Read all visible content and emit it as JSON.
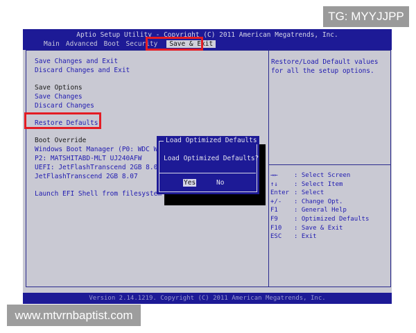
{
  "header": {
    "title": "Aptio Setup Utility - Copyright (C) 2011 American Megatrends, Inc.",
    "tabs": [
      "Main",
      "Advanced",
      "Boot",
      "Security",
      "Save & Exit"
    ]
  },
  "menu": {
    "save_changes_and_exit": "Save Changes and Exit",
    "discard_changes_and_exit": "Discard Changes and Exit",
    "save_options_heading": "Save Options",
    "save_changes": "Save Changes",
    "discard_changes": "Discard Changes",
    "restore_defaults": "Restore Defaults",
    "boot_override_heading": "Boot Override",
    "boot_items": [
      "Windows Boot Manager (P0: WDC WD7",
      "P2: MATSHITABD-MLT UJ240AFW",
      "UEFI: JetFlashTranscend 2GB 8.07",
      "JetFlashTranscend 2GB 8.07"
    ],
    "launch_efi_shell": "Launch EFI Shell from filesystem"
  },
  "help_text": "Restore/Load Default values\nfor all the setup options.",
  "keys": [
    {
      "key": "→←",
      "desc": ": Select Screen"
    },
    {
      "key": "↑↓",
      "desc": ": Select Item"
    },
    {
      "key": "Enter",
      "desc": ": Select"
    },
    {
      "key": "+/-",
      "desc": ": Change Opt."
    },
    {
      "key": "F1",
      "desc": ": General Help"
    },
    {
      "key": "F9",
      "desc": ": Optimized Defaults"
    },
    {
      "key": "F10",
      "desc": ": Save & Exit"
    },
    {
      "key": "ESC",
      "desc": ": Exit"
    }
  ],
  "dialog": {
    "title": "Load Optimized Defaults",
    "message": "Load Optimized Defaults?",
    "yes": "Yes",
    "no": "No"
  },
  "footer": "Version 2.14.1219. Copyright (C) 2011 American Megatrends, Inc.",
  "overlays": {
    "tg": "TG: MYYJJPP",
    "url": "www.mtvrnbaptist.com"
  },
  "colors": {
    "bios_blue": "#1d1a96",
    "panel_gray": "#c9c9d3",
    "highlight_red": "#e31c24",
    "menu_text_blue": "#1f1ab0"
  }
}
